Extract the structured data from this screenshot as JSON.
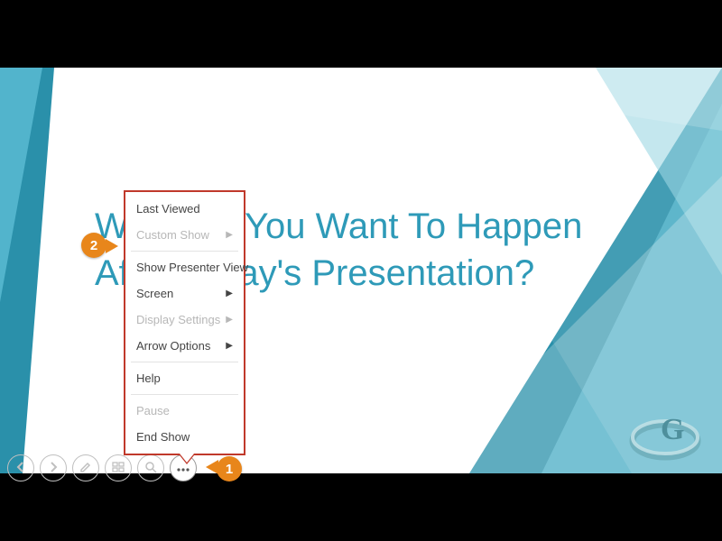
{
  "slide": {
    "title": "What Do You Want To Happen After Today's Presentation?",
    "theme_color": "#2e9ab8"
  },
  "menu": {
    "items": [
      {
        "label": "Last Viewed",
        "enabled": true,
        "submenu": false
      },
      {
        "label": "Custom Show",
        "enabled": false,
        "submenu": true
      },
      {
        "label": "Show Presenter View",
        "enabled": true,
        "submenu": false
      },
      {
        "label": "Screen",
        "enabled": true,
        "submenu": true
      },
      {
        "label": "Display Settings",
        "enabled": false,
        "submenu": true
      },
      {
        "label": "Arrow Options",
        "enabled": true,
        "submenu": true
      },
      {
        "label": "Help",
        "enabled": true,
        "submenu": false
      },
      {
        "label": "Pause",
        "enabled": false,
        "submenu": false
      },
      {
        "label": "End Show",
        "enabled": true,
        "submenu": false
      }
    ]
  },
  "controls": {
    "items": [
      {
        "name": "prev-slide-button",
        "icon": "chevron-left-icon",
        "interactable": true
      },
      {
        "name": "next-slide-button",
        "icon": "chevron-right-icon",
        "interactable": true
      },
      {
        "name": "pen-button",
        "icon": "pen-icon",
        "interactable": true
      },
      {
        "name": "see-all-slides-button",
        "icon": "grid-icon",
        "interactable": true
      },
      {
        "name": "zoom-button",
        "icon": "magnifier-icon",
        "interactable": true
      },
      {
        "name": "more-options-button",
        "icon": "ellipsis-icon",
        "interactable": true,
        "active": true
      }
    ]
  },
  "callouts": {
    "c1": "1",
    "c2": "2"
  },
  "caret": "▶"
}
